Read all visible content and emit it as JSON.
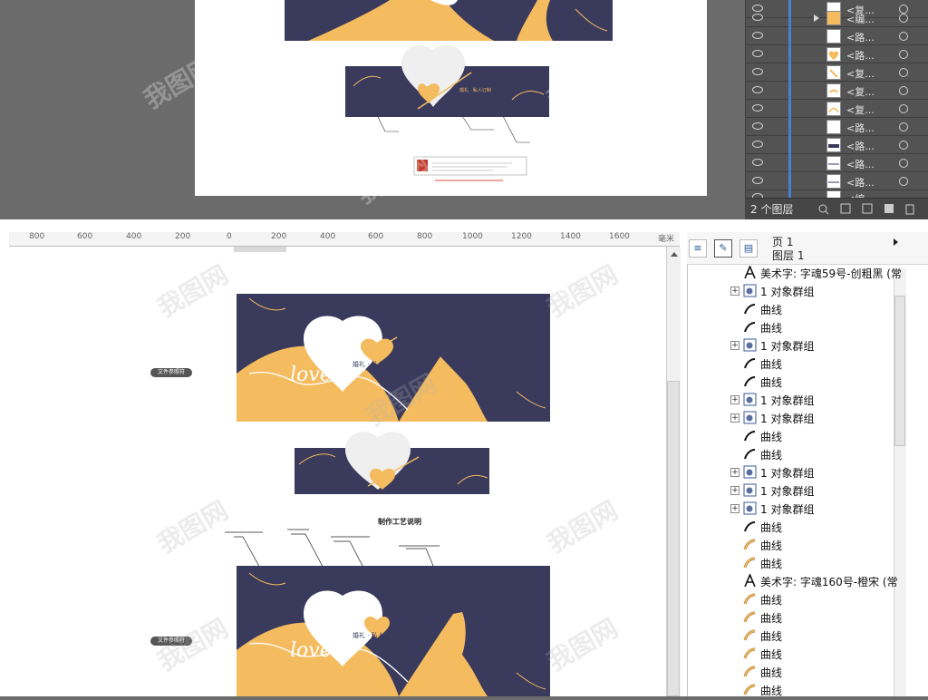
{
  "layers_panel": {
    "rows": [
      {
        "name": "<复..."
      },
      {
        "name": "<编..."
      },
      {
        "name": "<路..."
      },
      {
        "name": "<路..."
      },
      {
        "name": "<复..."
      },
      {
        "name": "<复..."
      },
      {
        "name": "<复..."
      },
      {
        "name": "<路..."
      },
      {
        "name": "<路..."
      },
      {
        "name": "<路..."
      },
      {
        "name": "<路..."
      },
      {
        "name": "<编..."
      }
    ],
    "footer_count": "2 个图层"
  },
  "artboard": {
    "small_label_text": "婚礼 · 私人订制"
  },
  "ruler": {
    "ticks": [
      "800",
      "600",
      "400",
      "200",
      "0",
      "200",
      "400",
      "600",
      "800",
      "1000",
      "1200",
      "1400",
      "1600"
    ],
    "unit": "毫米"
  },
  "canvas": {
    "banner_text": "婚礼 · 私人订制",
    "love_text": "love",
    "side_label_1": "文件参照符",
    "side_label_2": "文件参照符",
    "process_title": "制作工艺说明"
  },
  "object_manager": {
    "page_label": "页 1",
    "layer_label": "图层 1",
    "items": [
      {
        "type": "art",
        "label": "美术字: 字魂59号-创粗黑 (常"
      },
      {
        "type": "group",
        "label": "1 对象群组"
      },
      {
        "type": "curve",
        "label": "曲线"
      },
      {
        "type": "curve",
        "label": "曲线"
      },
      {
        "type": "group",
        "label": "1 对象群组"
      },
      {
        "type": "curve",
        "label": "曲线"
      },
      {
        "type": "curve",
        "label": "曲线"
      },
      {
        "type": "group",
        "label": "1 对象群组"
      },
      {
        "type": "group",
        "label": "1 对象群组"
      },
      {
        "type": "curve",
        "label": "曲线"
      },
      {
        "type": "curve",
        "label": "曲线"
      },
      {
        "type": "group",
        "label": "1 对象群组"
      },
      {
        "type": "group",
        "label": "1 对象群组"
      },
      {
        "type": "group",
        "label": "1 对象群组"
      },
      {
        "type": "curve",
        "label": "曲线"
      },
      {
        "type": "curve2",
        "label": "曲线"
      },
      {
        "type": "curve2",
        "label": "曲线"
      },
      {
        "type": "art",
        "label": "美术字: 字魂160号-橙宋 (常"
      },
      {
        "type": "curve2",
        "label": "曲线"
      },
      {
        "type": "curve2",
        "label": "曲线"
      },
      {
        "type": "curve2",
        "label": "曲线"
      },
      {
        "type": "curve2",
        "label": "曲线"
      },
      {
        "type": "curve2",
        "label": "曲线"
      },
      {
        "type": "curve2",
        "label": "曲线"
      }
    ]
  },
  "colors": {
    "navy": "#3a3a5c",
    "gold": "#f4bb5f",
    "panel_dark": "#535353"
  },
  "watermark_text": "我图网"
}
